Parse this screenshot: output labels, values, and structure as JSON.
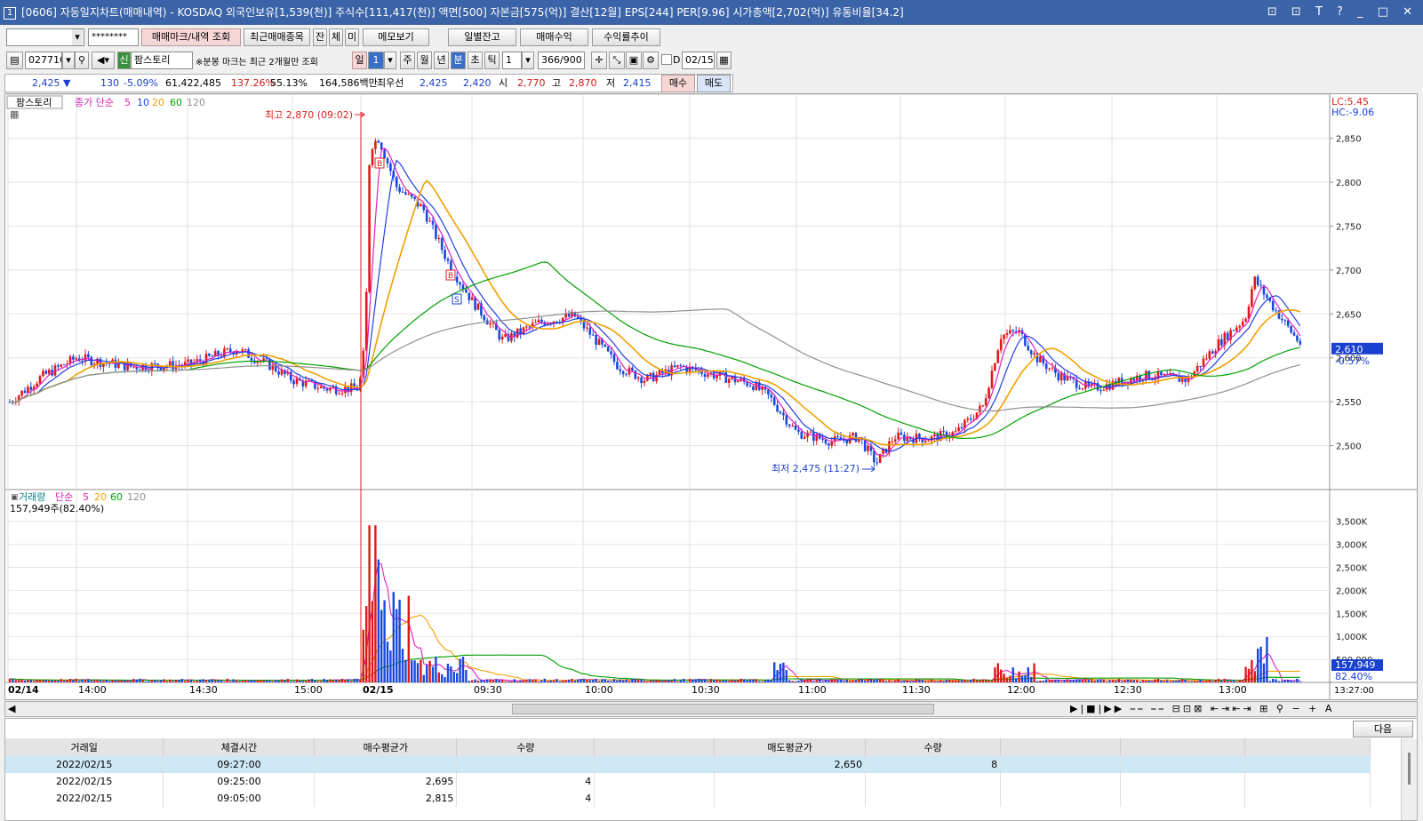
{
  "title": {
    "num": "1",
    "text": "[0606] 자동일지차트(매매내역) - KOSDAQ 외국인보유[1,539(천)] 주식수[111,417(천)] 액면[500] 자본금[575(억)] 결산[12월] EPS[244] PER[9.96] 시가총액[2,702(억)] 유통비율[34.2]",
    "icons": "⊡ ⊡ T ? _ □ ✕"
  },
  "row1": {
    "account_mask": "********",
    "b1": "매매마크/내역 조회",
    "b2": "최근매매종목",
    "b3": "잔",
    "b4": "체",
    "b5": "미",
    "b6": "메모보기",
    "b7": "일별잔고",
    "b8": "매매수익",
    "b9": "수익률추이"
  },
  "row2": {
    "code": "027710",
    "new_badge": "신",
    "stock_name": "팜스토리",
    "note": "※분봉 마크는 최근 2개월만 조회",
    "day": "일",
    "day_num": "1",
    "week": "주",
    "month": "월",
    "year": "년",
    "minute": "분",
    "tick": "초",
    "tick2": "틱",
    "interval": "1",
    "count": "366/900",
    "chk_d": "D",
    "date": "02/15"
  },
  "quote": {
    "price": "2,425",
    "arrow": "▼",
    "change": "130",
    "rate": "-5.09%",
    "volume": "61,422,485",
    "vol_ratio": "137.26%",
    "turnover": "55.13%",
    "amount": "164,586백만",
    "best_ask_label": "최우선",
    "best_ask": "2,425",
    "best_bid": "2,420",
    "open_label": "시",
    "open": "2,770",
    "high_label": "고",
    "high": "2,870",
    "low_label": "저",
    "low": "2,415",
    "buy": "매수",
    "sell": "매도"
  },
  "chart": {
    "panel_name": "팜스토리",
    "legend_label": "종가 단순",
    "ma": [
      "5",
      "10",
      "20",
      "60",
      "120"
    ],
    "ma_colors": [
      "#e020c0",
      "#2040e0",
      "#f0a000",
      "#00a000",
      "#909090"
    ],
    "lc": "LC:5.45",
    "hc": "HC:-9.06",
    "high_note": "최고 2,870 (09:02)",
    "low_note": "최저 2,475 (11:27)",
    "current_price": "2,610",
    "current_rate": "-0.57%",
    "price_ticks": [
      "2,850",
      "2,800",
      "2,750",
      "2,700",
      "2,650",
      "2,600",
      "2,550",
      "2,500"
    ],
    "vol_label": "거래량",
    "vol_legend_label": "단순",
    "vol_ma": [
      "5",
      "20",
      "60",
      "120"
    ],
    "vol_info": "157,949주(82.40%)",
    "vol_ticks": [
      "3,500K",
      "3,000K",
      "2,500K",
      "2,000K",
      "1,500K",
      "1,000K",
      "500,000"
    ],
    "vol_current": "157,949",
    "vol_rate": "82.40%",
    "x_labels": [
      "02/14",
      "14:00",
      "14:30",
      "15:00",
      "02/15",
      "09:30",
      "10:00",
      "10:30",
      "11:00",
      "11:30",
      "12:00",
      "12:30",
      "13:00"
    ],
    "x_end": "13:27:00"
  },
  "chart_data": {
    "type": "line",
    "title": "",
    "xlabel": "",
    "ylabel": "",
    "ylim": [
      2455,
      2880
    ],
    "price_axis_ticks": [
      2500,
      2550,
      2600,
      2650,
      2700,
      2750,
      2800,
      2850
    ],
    "series": [
      {
        "name": "종가",
        "x": [
          "14:00",
          "14:30",
          "15:00",
          "09:02",
          "09:30",
          "10:00",
          "10:30",
          "11:00",
          "11:27",
          "12:00",
          "12:30",
          "13:00",
          "13:27"
        ],
        "values": [
          2600,
          2615,
          2580,
          2870,
          2660,
          2645,
          2590,
          2560,
          2475,
          2640,
          2570,
          2600,
          2610
        ]
      }
    ],
    "volume": {
      "ylim": [
        0,
        3900000
      ],
      "notes": "peak volume near 09:02 ~3,700K"
    }
  },
  "scroll": {
    "next": "다음"
  },
  "table": {
    "headers": [
      "거래일",
      "체결시간",
      "매수평균가",
      "수량",
      "",
      "매도평균가",
      "수량",
      "",
      "",
      ""
    ],
    "rows": [
      [
        "2022/02/15",
        "09:27:00",
        "",
        "",
        "",
        "2,650",
        "8",
        "",
        "",
        ""
      ],
      [
        "2022/02/15",
        "09:25:00",
        "2,695",
        "4",
        "",
        "",
        "",
        "",
        "",
        ""
      ],
      [
        "2022/02/15",
        "09:05:00",
        "2,815",
        "4",
        "",
        "",
        "",
        "",
        "",
        ""
      ]
    ]
  }
}
